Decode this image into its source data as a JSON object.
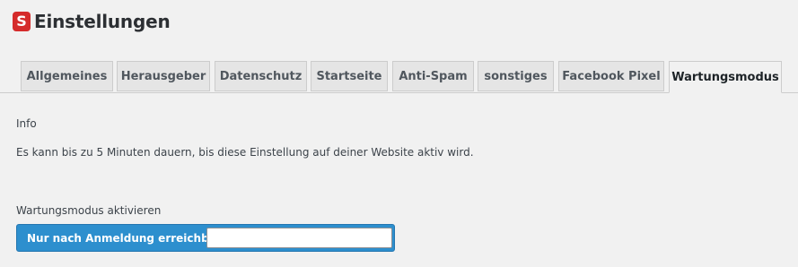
{
  "header": {
    "logo_letter": "S",
    "title": "Einstellungen"
  },
  "tabs": [
    {
      "label": "Allgemeines",
      "active": false
    },
    {
      "label": "Herausgeber",
      "active": false
    },
    {
      "label": "Datenschutz",
      "active": false
    },
    {
      "label": "Startseite",
      "active": false
    },
    {
      "label": "Anti-Spam",
      "active": false
    },
    {
      "label": "sonstiges",
      "active": false
    },
    {
      "label": "Facebook Pixel",
      "active": false
    },
    {
      "label": "Wartungsmodus",
      "active": true
    }
  ],
  "info": {
    "heading": "Info",
    "text": "Es kann bis zu 5 Minuten dauern, bis diese Einstellung auf deiner Website aktiv wird."
  },
  "maintenance": {
    "label": "Wartungsmodus aktivieren",
    "option_label": "Nur nach Anmeldung erreichbar.",
    "input_value": ""
  },
  "colors": {
    "brand": "#d52b2b",
    "accent": "#2d8fce",
    "background": "#f1f1f1"
  }
}
